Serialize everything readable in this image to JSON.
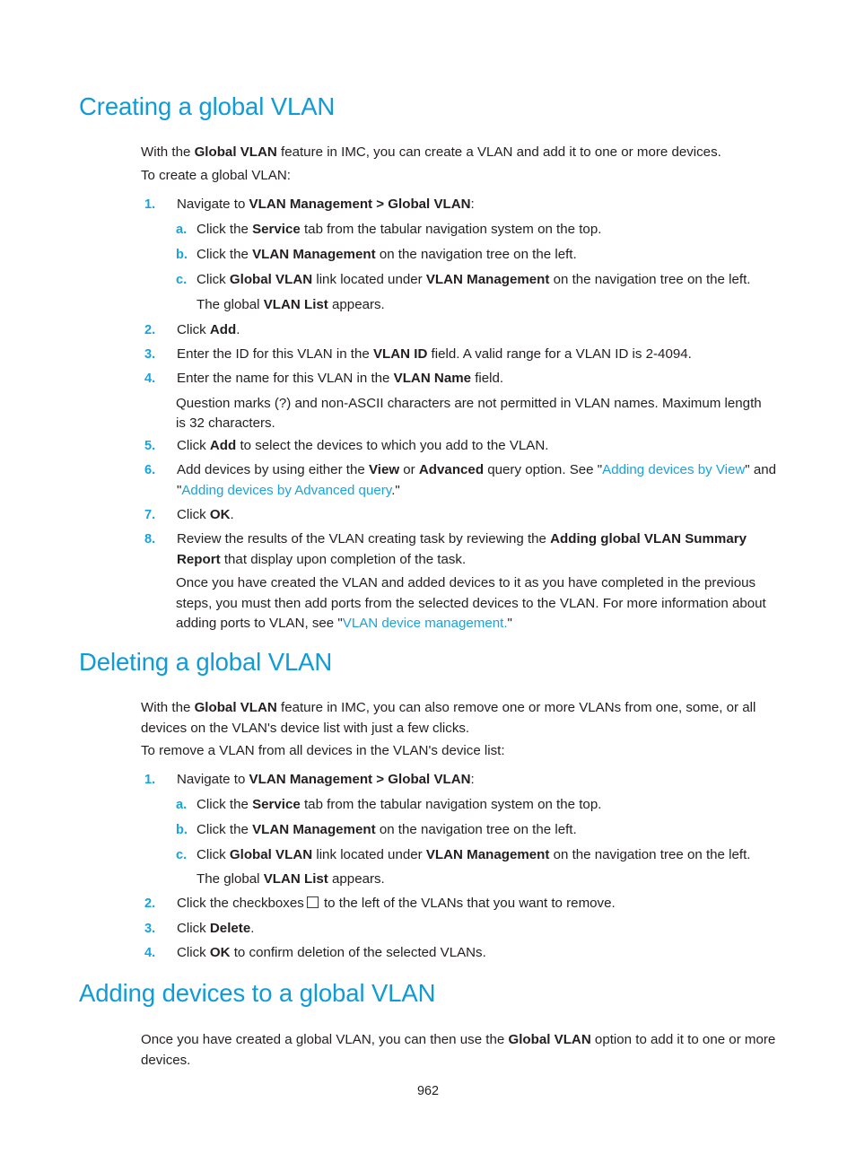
{
  "page": {
    "number": "962",
    "accent_heading_color": "#0f9bd7",
    "accent_marker_color": "#19a3dc",
    "link_color": "#19a3dc",
    "text_color": "#231f20"
  },
  "sections": [
    {
      "id": "creating-a-global-vlan",
      "title": "Creating a global VLAN",
      "intro_1_pre": "With the ",
      "intro_1_bold": "Global VLAN",
      "intro_1_post": " feature in IMC, you can create a VLAN and add it to one or more devices.",
      "intro_2": "To create a global VLAN:",
      "steps": [
        {
          "marker": "1.",
          "pre": "Navigate to ",
          "bold": "VLAN Management > Global VLAN",
          "post": ":",
          "substeps": [
            {
              "marker": "a.",
              "pre": "Click the ",
              "bold": "Service",
              "post": " tab from the tabular navigation system on the top."
            },
            {
              "marker": "b.",
              "pre": "Click the ",
              "bold": "VLAN Management",
              "post": " on the navigation tree on the left."
            },
            {
              "marker": "c.",
              "pre": "Click ",
              "bold": "Global VLAN",
              "mid": " link located under ",
              "bold2": "VLAN Management",
              "post": " on the navigation tree on the left."
            }
          ],
          "trailing_note_pre": "The global ",
          "trailing_note_bold": "VLAN List",
          "trailing_note_post": " appears."
        },
        {
          "marker": "2.",
          "pre": "Click ",
          "bold": "Add",
          "post": "."
        },
        {
          "marker": "3.",
          "pre": "Enter the ID for this VLAN in the ",
          "bold": "VLAN ID",
          "post": " field. A valid range for a VLAN ID is 2-4094."
        },
        {
          "marker": "4.",
          "pre": "Enter the name for this VLAN in the ",
          "bold": "VLAN Name",
          "post": " field."
        },
        {
          "marker": "5.",
          "pre": "Click ",
          "bold": "Add",
          "post": " to select the devices to which you add to the VLAN."
        },
        {
          "marker": "6.",
          "pre": "Add devices by using either the ",
          "bold": "View",
          "mid": " or ",
          "bold2": "Advanced",
          "post": " query option. See \"",
          "link1": "Adding devices by View",
          "between": "\" and \"",
          "link2": "Adding devices by Advanced query",
          "tail": ".\""
        },
        {
          "marker": "7.",
          "pre": "Click ",
          "bold": "OK",
          "post": "."
        },
        {
          "marker": "8.",
          "pre": "Review the results of the VLAN creating task by reviewing the ",
          "bold": "Adding global VLAN Summary Report",
          "post": " that display upon completion of the task."
        }
      ],
      "note_after_4_line1": "Question marks (?) and non-ASCII characters are not permitted in VLAN names. Maximum length",
      "note_after_4_line2": "is 32 characters.",
      "closing_pre": "Once you have created the VLAN and added devices to it as you have completed in the previous steps, you must then add ports from the selected devices to the VLAN. For more information about adding ports to VLAN, see \"",
      "closing_link": "VLAN device management.",
      "closing_post": "\""
    },
    {
      "id": "deleting-a-global-vlan",
      "title": "Deleting a global VLAN",
      "intro_1_pre": "With the ",
      "intro_1_bold": "Global VLAN",
      "intro_1_post": " feature in IMC, you can also remove one or more VLANs from one, some, or all devices on the VLAN's device list with just a few clicks.",
      "intro_2": "To remove a VLAN from all devices in the VLAN's device list:",
      "steps": [
        {
          "marker": "1.",
          "pre": "Navigate to ",
          "bold": "VLAN Management > Global VLAN",
          "post": ":",
          "substeps": [
            {
              "marker": "a.",
              "pre": "Click the ",
              "bold": "Service",
              "post": " tab from the tabular navigation system on the top."
            },
            {
              "marker": "b.",
              "pre": "Click the ",
              "bold": "VLAN Management",
              "post": " on the navigation tree on the left."
            },
            {
              "marker": "c.",
              "pre": "Click ",
              "bold": "Global VLAN",
              "mid": " link located under ",
              "bold2": "VLAN Management",
              "post": " on the navigation tree on the left."
            }
          ],
          "trailing_note_pre": "The global ",
          "trailing_note_bold": "VLAN List",
          "trailing_note_post": " appears."
        },
        {
          "marker": "2.",
          "pre": "Click the checkboxes",
          "checkbox_icon": "empty-checkbox",
          "post": " to the left of the VLANs that you want to remove."
        },
        {
          "marker": "3.",
          "pre": "Click ",
          "bold": "Delete",
          "post": "."
        },
        {
          "marker": "4.",
          "pre": "Click ",
          "bold": "OK",
          "post": " to confirm deletion of the selected VLANs."
        }
      ]
    },
    {
      "id": "adding-devices-to-a-global-vlan",
      "title": "Adding devices to a global VLAN",
      "intro_1_pre": "Once you have created a global VLAN, you can then use the ",
      "intro_1_bold": "Global VLAN",
      "intro_1_post": " option to add it to one or more devices."
    }
  ]
}
